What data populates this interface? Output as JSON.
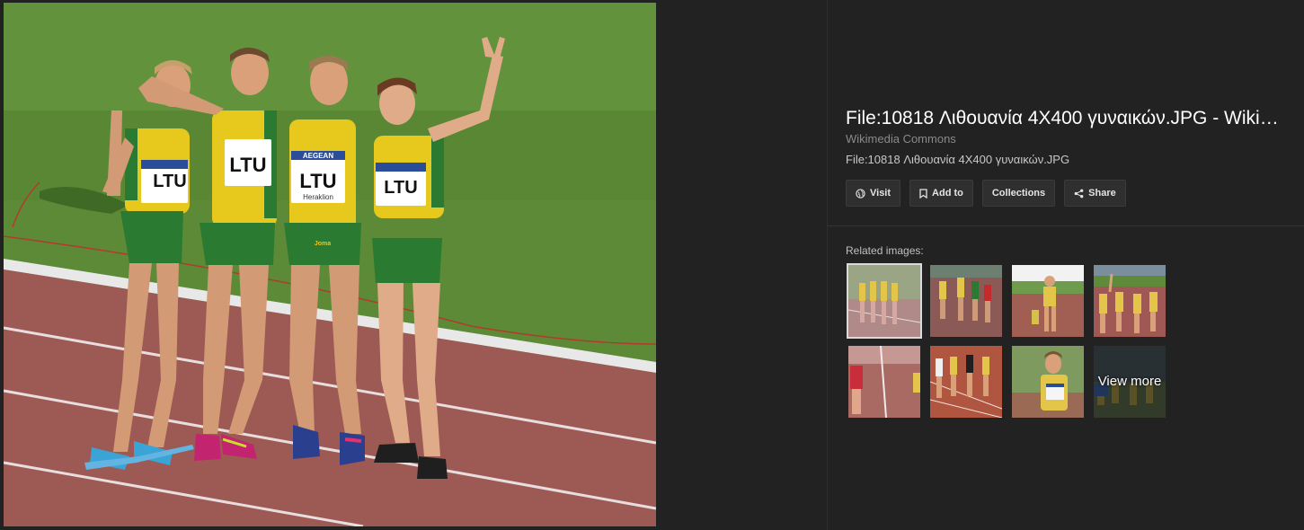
{
  "image": {
    "title": "File:10818 Λιθουανία 4X400 γυναικών.JPG - Wiki…",
    "source": "Wikimedia Commons",
    "filename": "File:10818 Λιθουανία 4X400 γυναικών.JPG",
    "bib_texts": [
      "LTU",
      "LTU",
      "LTU",
      "LTU"
    ],
    "sponsor_text": "AEGEAN",
    "city_text": "Heraklion",
    "brand_text": "Joma"
  },
  "actions": {
    "visit": "Visit",
    "add_to": "Add to",
    "collections": "Collections",
    "share": "Share"
  },
  "related": {
    "label": "Related images:",
    "view_more": "View more"
  },
  "colors": {
    "background": "#222222",
    "grass": "#5c8a37",
    "track": "#9d5a55",
    "jersey_yellow": "#e7c81d",
    "jersey_green": "#2a7a32"
  }
}
